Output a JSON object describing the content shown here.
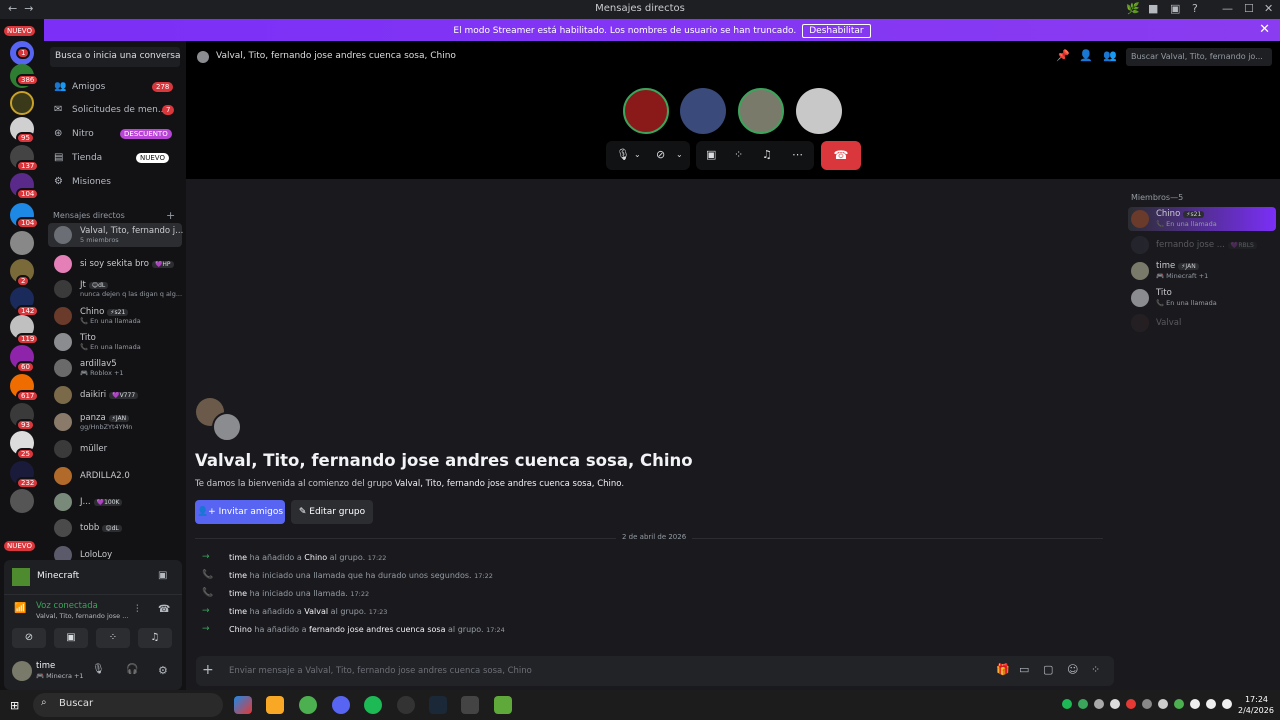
{
  "window": {
    "title": "Mensajes directos",
    "controls": [
      "—",
      "☐",
      "✕"
    ]
  },
  "banner": {
    "text": "El modo Streamer está habilitado. Los nombres de usuario se han truncado.",
    "button": "Deshabilitar"
  },
  "guild_badges": {
    "nuevo_top": "NUEVO",
    "nuevo_bottom": "NUEVO",
    "counts": [
      "1",
      "386",
      "95",
      "137",
      "104",
      "104",
      "2",
      "142",
      "119",
      "60",
      "617",
      "93",
      "25",
      "232"
    ]
  },
  "sidebar": {
    "search_placeholder": "Busca o inicia una conversaci...",
    "nav": [
      {
        "label": "Amigos",
        "badge": "278",
        "icon": "friends-icon"
      },
      {
        "label": "Solicitudes de men...",
        "badge": "7",
        "icon": "envelope-icon"
      },
      {
        "label": "Nitro",
        "badge": "DESCUENTO",
        "icon": "nitro-icon"
      },
      {
        "label": "Tienda",
        "badge": "NUEVO",
        "icon": "shop-icon"
      },
      {
        "label": "Misiones",
        "badge": "",
        "icon": "quests-icon"
      }
    ],
    "dm_header": "Mensajes directos",
    "dms": [
      {
        "name": "Valval, Tito, fernando j...",
        "sub": "5 miembros",
        "tag": "",
        "color": "#6b6e74"
      },
      {
        "name": "si soy sekita bro",
        "sub": "",
        "tag": "💜HP",
        "color": "#e57fb7"
      },
      {
        "name": "Jt",
        "sub": "nunca dejen q las digan q alg...",
        "tag": "😊dL",
        "color": "#3a3a3a"
      },
      {
        "name": "Chino",
        "sub": "📞 En una llamada",
        "tag": "⚡s21",
        "color": "#6a3a2a"
      },
      {
        "name": "Tito",
        "sub": "📞 En una llamada",
        "tag": "",
        "color": "#8a8c90"
      },
      {
        "name": "ardillav5",
        "sub": "🎮 Roblox +1",
        "tag": "",
        "color": "#6a6a6a"
      },
      {
        "name": "daikiri",
        "sub": "",
        "tag": "💜V777",
        "color": "#7a6a4a"
      },
      {
        "name": "panza",
        "sub": "gg/HnbZYt4YMn",
        "tag": "⚡JAN",
        "color": "#8a7a6a"
      },
      {
        "name": "müller",
        "sub": "",
        "tag": "",
        "color": "#3a3a3a"
      },
      {
        "name": "ARDILLA2.0",
        "sub": "",
        "tag": "",
        "color": "#b26a2a"
      },
      {
        "name": "J...",
        "sub": "",
        "tag": "💜100K",
        "color": "#7a8a7a"
      },
      {
        "name": "tobb",
        "sub": "",
        "tag": "😊dL",
        "color": "#4a4a4a"
      },
      {
        "name": "LoloLoy",
        "sub": "",
        "tag": "",
        "color": "#5a5a6a"
      }
    ]
  },
  "user_panel": {
    "activity": "Minecraft",
    "voice_status": "Voz conectada",
    "voice_channel": "Valval, Tito, fernando jose ...",
    "username": "time",
    "user_sub": "🎮 Minecra +1"
  },
  "header": {
    "title": "Valval, Tito, fernando jose andres cuenca sosa, Chino",
    "search_placeholder": "Buscar Valval, Tito, fernando jo..."
  },
  "call": {
    "participants": [
      {
        "name": "Valval",
        "color": "#8a1a1a"
      },
      {
        "name": "fernando jose andres cuenca sosa",
        "color": "#3a4a7a"
      },
      {
        "name": "Tito",
        "color": "#7a7a6a"
      },
      {
        "name": "Chino",
        "color": "#c8c8c8"
      }
    ]
  },
  "welcome": {
    "title": "Valval, Tito, fernando jose andres cuenca sosa, Chino",
    "subtitle_prefix": "Te damos la bienvenida al comienzo del grupo",
    "subtitle_group": "Valval, Tito, fernando jose andres cuenca sosa, Chino",
    "invite_button": "Invitar amigos",
    "edit_button": "Editar grupo"
  },
  "date_separator": "2 de abril de 2026",
  "messages": [
    {
      "icon": "→",
      "user": "time",
      "text": "ha añadido a",
      "target": "Chino",
      "tail": "al grupo.",
      "time": "17:22"
    },
    {
      "icon": "📞",
      "user": "time",
      "text": "ha iniciado una llamada que ha durado unos segundos.",
      "target": "",
      "tail": "",
      "time": "17:22"
    },
    {
      "icon": "📞",
      "user": "time",
      "text": "ha iniciado una llamada.",
      "target": "",
      "tail": "",
      "time": "17:22"
    },
    {
      "icon": "→",
      "user": "time",
      "text": "ha añadido a",
      "target": "Valval",
      "tail": "al grupo.",
      "time": "17:23"
    },
    {
      "icon": "→",
      "user": "Chino",
      "text": "ha añadido a",
      "target": "fernando jose andres cuenca sosa",
      "tail": "al grupo.",
      "time": "17:24"
    }
  ],
  "composer": {
    "placeholder": "Enviar mensaje a Valval, Tito, fernando jose andres cuenca sosa, Chino"
  },
  "members": {
    "header": "Miembros—5",
    "list": [
      {
        "name": "Chino",
        "sub": "📞 En una llamada",
        "tag": "⚡s21",
        "color": "#6a3a2a"
      },
      {
        "name": "fernando jose ...",
        "sub": "",
        "tag": "💜RBLS",
        "color": "#3a3a4a"
      },
      {
        "name": "time",
        "sub": "🎮 Minecraft +1",
        "tag": "⚡JAN",
        "color": "#7a7a6a"
      },
      {
        "name": "Tito",
        "sub": "📞 En una llamada",
        "tag": "",
        "color": "#8a8c90"
      },
      {
        "name": "Valval",
        "sub": "",
        "tag": "",
        "color": "#3a2a2a"
      }
    ]
  },
  "taskbar": {
    "search": "Buscar",
    "time": "17:24",
    "date": "2/4/2026"
  }
}
